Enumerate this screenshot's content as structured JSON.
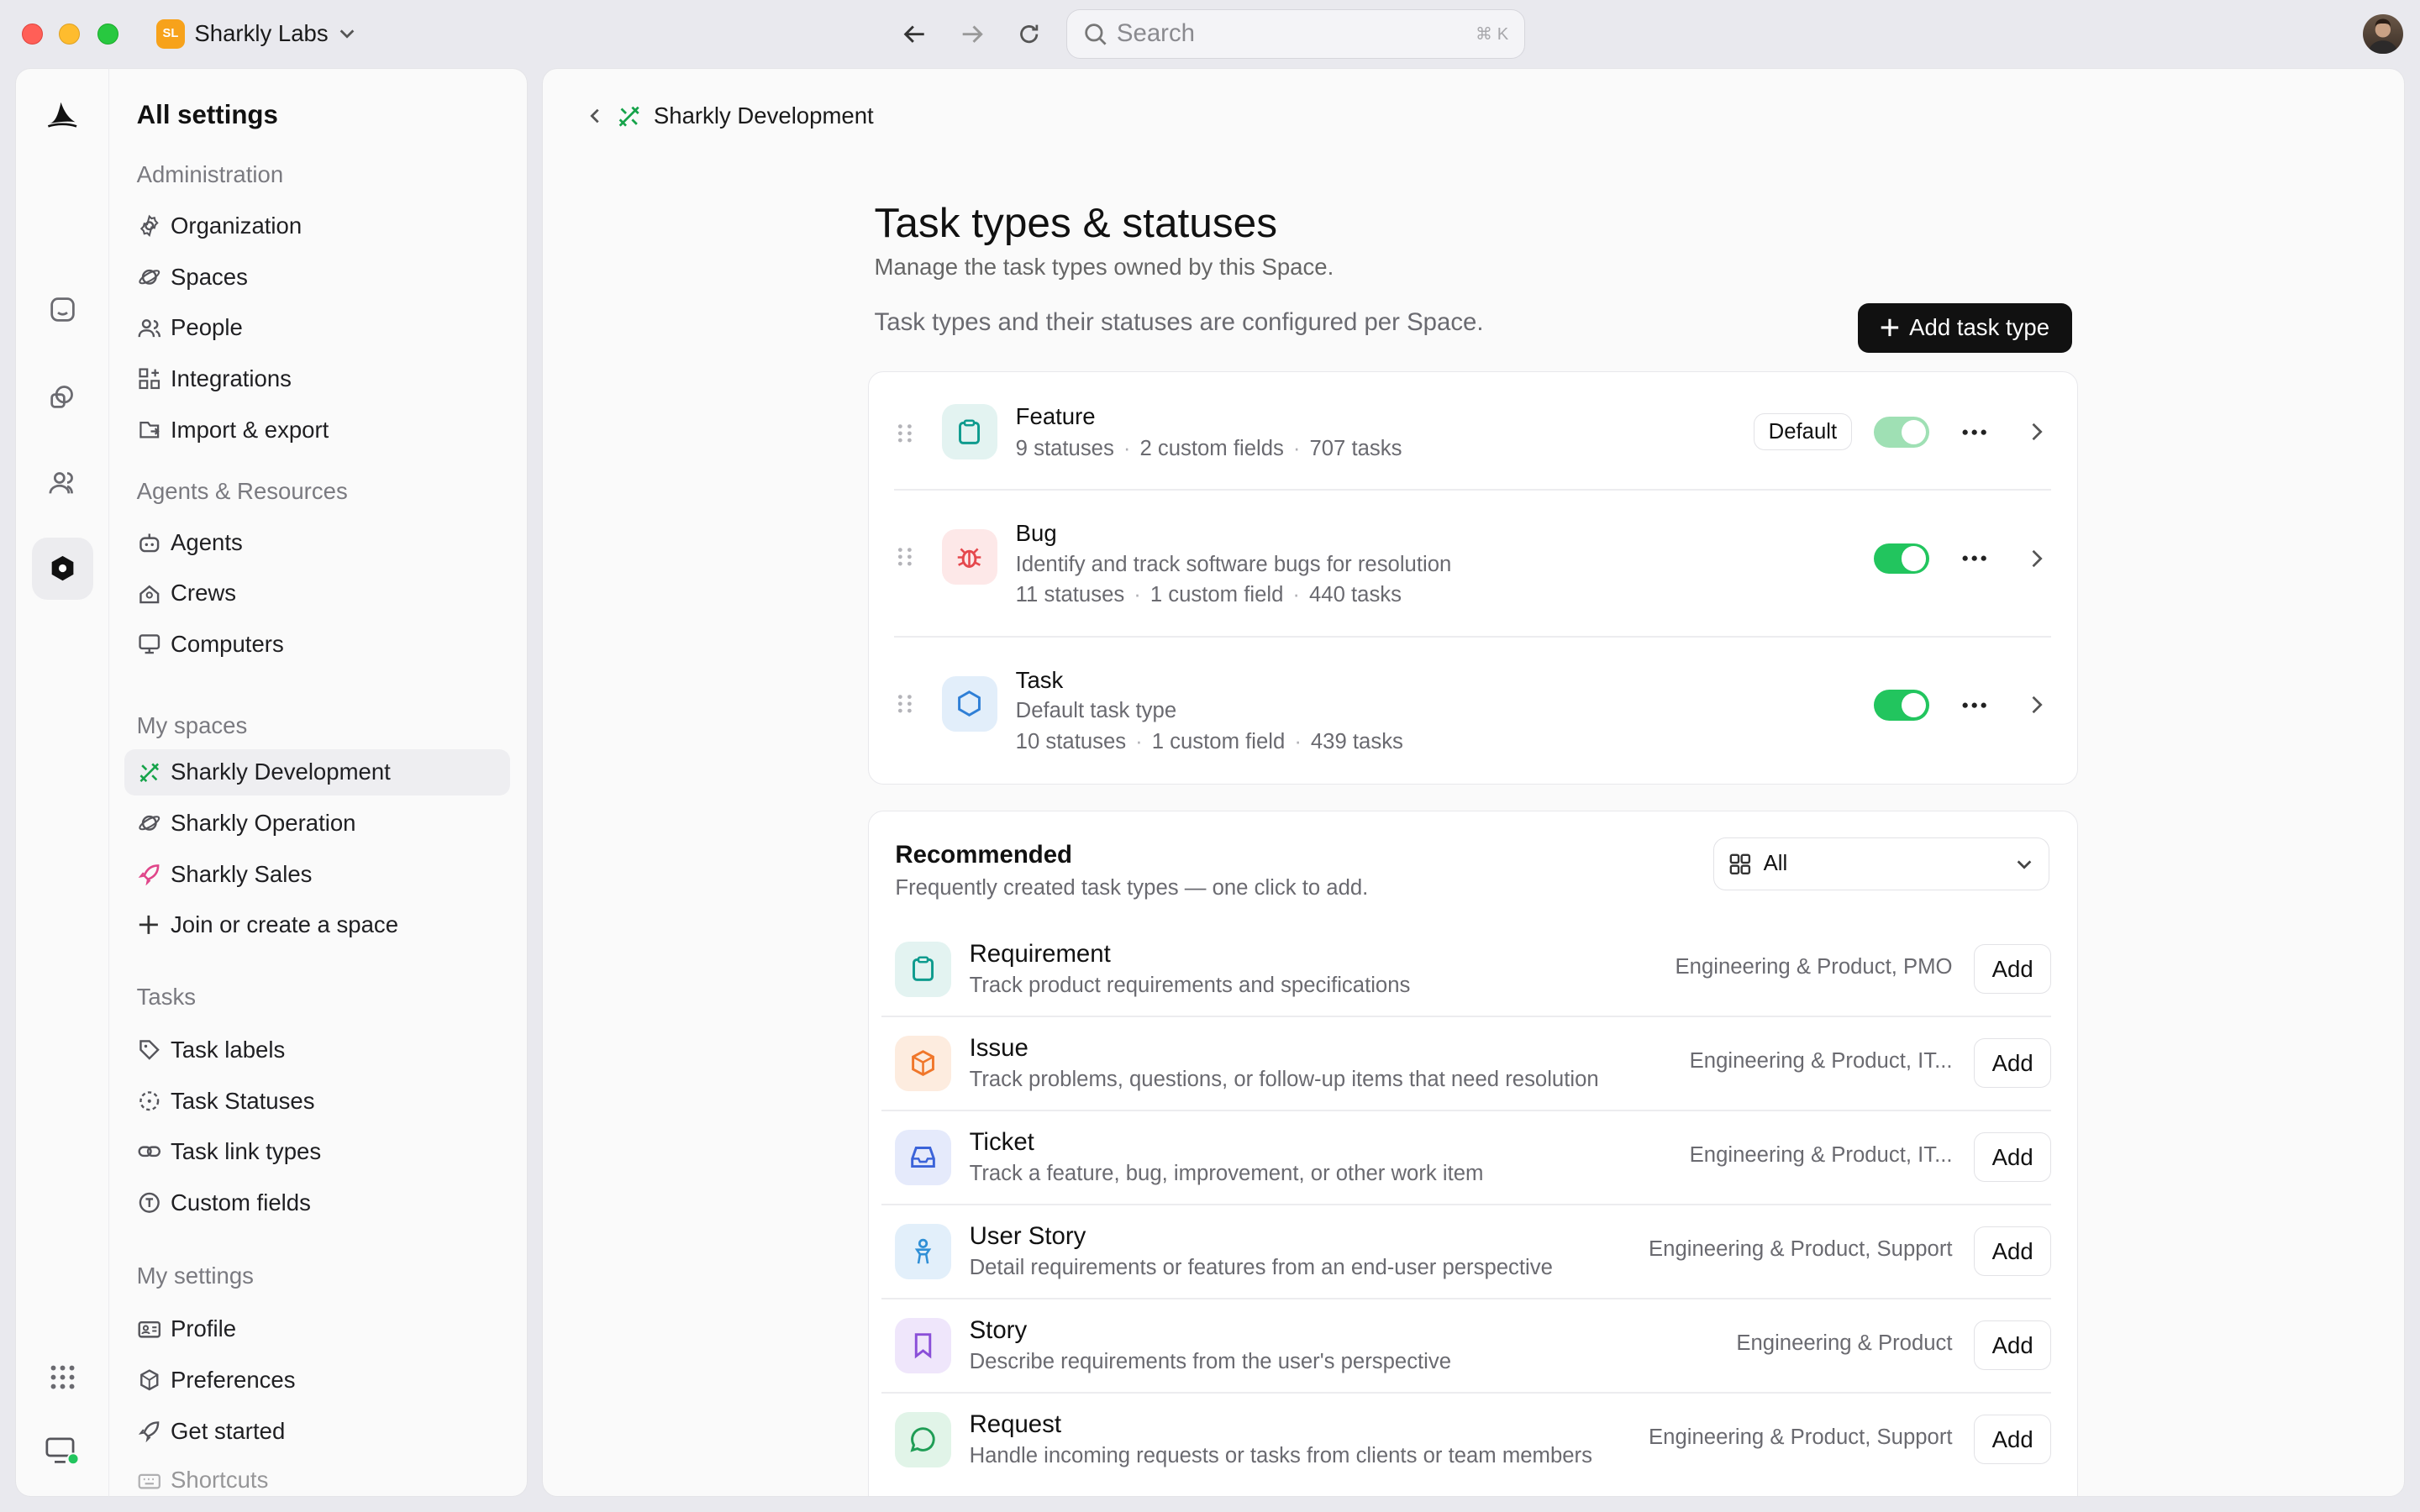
{
  "titlebar": {
    "org_initials": "SL",
    "org_name": "Sharkly Labs",
    "search_placeholder": "Search",
    "search_shortcut": "⌘ K"
  },
  "sidebar": {
    "title": "All settings",
    "sections": [
      {
        "label": "Administration",
        "items": [
          {
            "label": "Organization",
            "icon": "gear-icon"
          },
          {
            "label": "Spaces",
            "icon": "planet-icon"
          },
          {
            "label": "People",
            "icon": "people-icon"
          },
          {
            "label": "Integrations",
            "icon": "grid-plus-icon"
          },
          {
            "label": "Import & export",
            "icon": "import-icon"
          }
        ]
      },
      {
        "label": "Agents & Resources",
        "items": [
          {
            "label": "Agents",
            "icon": "robot-icon"
          },
          {
            "label": "Crews",
            "icon": "crew-icon"
          },
          {
            "label": "Computers",
            "icon": "monitor-icon"
          }
        ]
      },
      {
        "label": "My spaces",
        "items": [
          {
            "label": "Sharkly Development",
            "icon": "tools-icon",
            "active": true
          },
          {
            "label": "Sharkly Operation",
            "icon": "planet-icon"
          },
          {
            "label": "Sharkly Sales",
            "icon": "rocket-icon"
          },
          {
            "label": "Join or create a space",
            "icon": "plus-icon"
          }
        ]
      },
      {
        "label": "Tasks",
        "items": [
          {
            "label": "Task labels",
            "icon": "tag-icon"
          },
          {
            "label": "Task Statuses",
            "icon": "dashed-circle-icon"
          },
          {
            "label": "Task link types",
            "icon": "link-icon"
          },
          {
            "label": "Custom fields",
            "icon": "custom-field-icon"
          }
        ]
      },
      {
        "label": "My settings",
        "items": [
          {
            "label": "Profile",
            "icon": "id-card-icon"
          },
          {
            "label": "Preferences",
            "icon": "preferences-icon"
          },
          {
            "label": "Get started",
            "icon": "rocket-icon"
          },
          {
            "label": "Shortcuts",
            "icon": "keyboard-icon"
          }
        ]
      }
    ]
  },
  "main": {
    "breadcrumb": "Sharkly Development",
    "title": "Task types & statuses",
    "subtitle": "Manage the task types owned by this Space.",
    "note": "Task types and their statuses are configured per Space.",
    "add_button": "Add task type",
    "task_types": [
      {
        "name": "Feature",
        "description": "",
        "statuses": "9 statuses",
        "fields": "2 custom fields",
        "tasks": "707 tasks",
        "badge": "Default",
        "enabled": true,
        "icon": "clipboard-icon",
        "color": "#0f9b8e",
        "bg": "#e3f3f1"
      },
      {
        "name": "Bug",
        "description": "Identify and track software bugs for resolution",
        "statuses": "11 statuses",
        "fields": "1 custom field",
        "tasks": "440 tasks",
        "badge": "",
        "enabled": true,
        "icon": "bug-icon",
        "color": "#e5484d",
        "bg": "#fde8e8"
      },
      {
        "name": "Task",
        "description": "Default task type",
        "statuses": "10 statuses",
        "fields": "1 custom field",
        "tasks": "439 tasks",
        "badge": "",
        "enabled": true,
        "icon": "hexagon-icon",
        "color": "#2f7fd6",
        "bg": "#e2eefa"
      }
    ],
    "recommended": {
      "title": "Recommended",
      "subtitle": "Frequently created task types — one click to add.",
      "filter": "All",
      "add_label": "Add",
      "items": [
        {
          "name": "Requirement",
          "description": "Track product requirements and specifications",
          "tags": "Engineering & Product, PMO",
          "icon": "clipboard-icon",
          "color": "#0f9b8e",
          "bg": "#e3f3f1"
        },
        {
          "name": "Issue",
          "description": "Track problems, questions, or follow-up items that need resolution",
          "tags": "Engineering & Product, IT...",
          "icon": "cube-icon",
          "color": "#f0772b",
          "bg": "#fdecdf"
        },
        {
          "name": "Ticket",
          "description": "Track a feature, bug, improvement, or other work item",
          "tags": "Engineering & Product, IT...",
          "icon": "inbox-icon",
          "color": "#3b63d9",
          "bg": "#e5eafb"
        },
        {
          "name": "User Story",
          "description": "Detail requirements or features from an end-user perspective",
          "tags": "Engineering & Product, Support",
          "icon": "person-icon",
          "color": "#2f8fd6",
          "bg": "#e2effa"
        },
        {
          "name": "Story",
          "description": "Describe requirements from the user's perspective",
          "tags": "Engineering & Product",
          "icon": "bookmark-icon",
          "color": "#8a4fd8",
          "bg": "#efe6fb"
        },
        {
          "name": "Request",
          "description": "Handle incoming requests or tasks from clients or team members",
          "tags": "Engineering & Product, Support",
          "icon": "chat-icon",
          "color": "#1f9d55",
          "bg": "#e1f4e8"
        }
      ]
    }
  }
}
